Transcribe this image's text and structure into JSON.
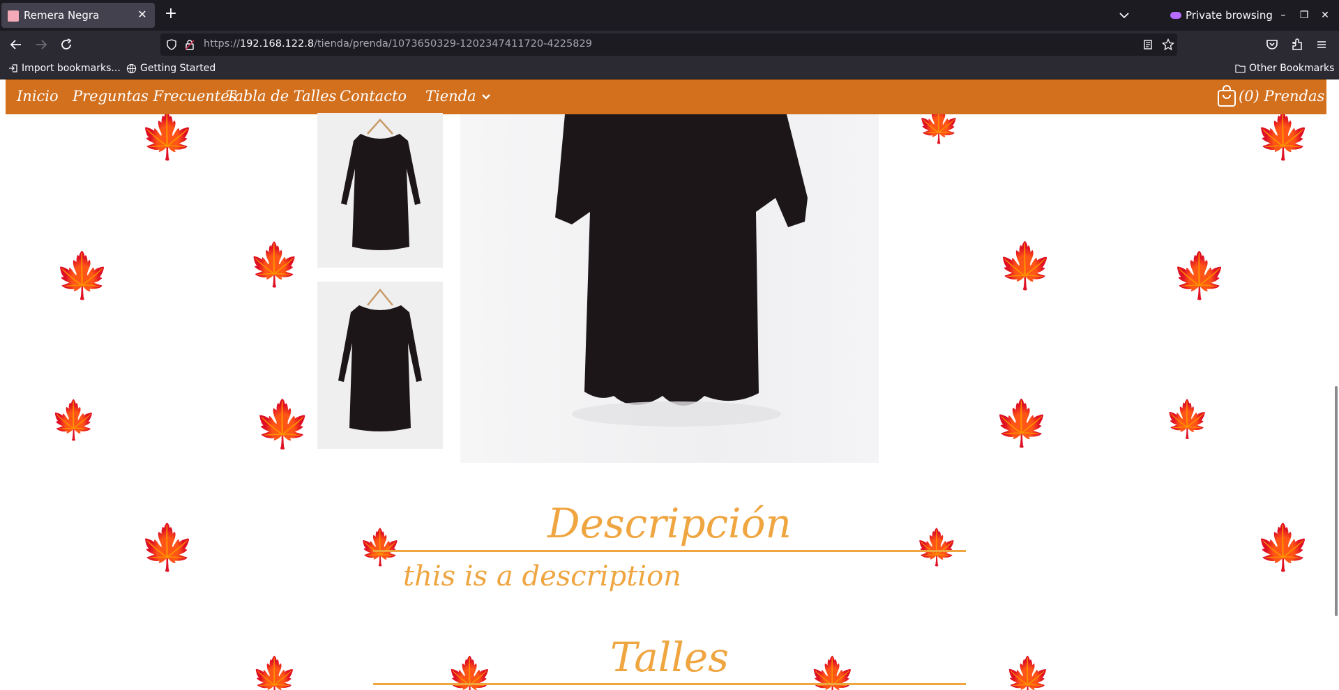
{
  "browser": {
    "tab_title": "Remera Negra",
    "private_label": "Private browsing",
    "url_prefix": "https://",
    "url_host": "192.168.122.8",
    "url_path": "/tienda/prenda/1073650329-1202347411720-4225829",
    "bookmarks": {
      "import_label": "Import bookmarks...",
      "getting_started_label": "Getting Started",
      "other_label": "Other Bookmarks"
    }
  },
  "site_nav": {
    "items": [
      "Inicio",
      "Preguntas Frecuentes",
      "Tabla de Talles",
      "Contacto"
    ],
    "store_label": "Tienda",
    "cart_label": "(0) Prendas"
  },
  "product": {
    "description_title": "Descripción",
    "description_text": "this is a description",
    "sizes_title": "Talles"
  },
  "colors": {
    "accent": "#d2701e",
    "heading": "#efa540",
    "leaf": "#ffd49a"
  }
}
